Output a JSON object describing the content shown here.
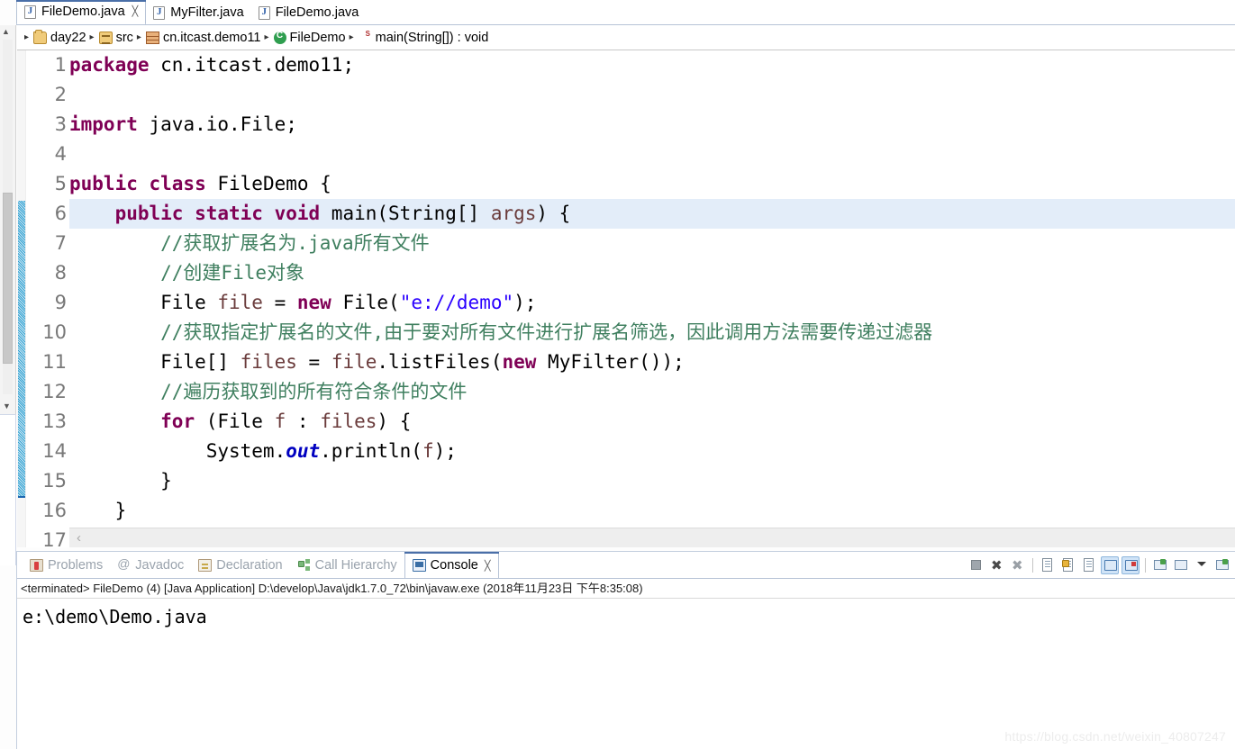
{
  "tabs": [
    {
      "label": "FileDemo.java",
      "icon": "java-file-icon",
      "active": true,
      "close": "╳"
    },
    {
      "label": "MyFilter.java",
      "icon": "java-file-icon",
      "active": false,
      "close": ""
    },
    {
      "label": "FileDemo.java",
      "icon": "java-file-icon",
      "active": false,
      "close": ""
    }
  ],
  "breadcrumb": {
    "leading_arrow": "▸",
    "separator": "▸",
    "items": [
      {
        "label": "day22",
        "icon": "project-folder-icon"
      },
      {
        "label": "src",
        "icon": "source-folder-icon"
      },
      {
        "label": "cn.itcast.demo11",
        "icon": "package-icon"
      },
      {
        "label": "FileDemo",
        "icon": "class-icon"
      },
      {
        "label": "main(String[]) : void",
        "icon": "method-icon"
      }
    ]
  },
  "editor": {
    "current_line": 6,
    "scroll_arrow": "‹",
    "lines": [
      {
        "num": "1",
        "tokens": [
          {
            "t": "package ",
            "c": "kw"
          },
          {
            "t": "cn.itcast.demo11;",
            "c": "pln"
          }
        ]
      },
      {
        "num": "2",
        "tokens": []
      },
      {
        "num": "3",
        "tokens": [
          {
            "t": "import ",
            "c": "kw"
          },
          {
            "t": "java.io.File;",
            "c": "pln"
          }
        ]
      },
      {
        "num": "4",
        "tokens": []
      },
      {
        "num": "5",
        "tokens": [
          {
            "t": "public class ",
            "c": "kw"
          },
          {
            "t": "FileDemo {",
            "c": "pln"
          }
        ]
      },
      {
        "num": "6",
        "tokens": [
          {
            "t": "    ",
            "c": "pln"
          },
          {
            "t": "public static void ",
            "c": "kw"
          },
          {
            "t": "main(String[] ",
            "c": "pln"
          },
          {
            "t": "args",
            "c": "loc"
          },
          {
            "t": ") {",
            "c": "pln"
          }
        ]
      },
      {
        "num": "7",
        "tokens": [
          {
            "t": "        //获取扩展名为.java所有文件",
            "c": "cmt"
          }
        ]
      },
      {
        "num": "8",
        "tokens": [
          {
            "t": "        //创建File对象",
            "c": "cmt"
          }
        ]
      },
      {
        "num": "9",
        "tokens": [
          {
            "t": "        File ",
            "c": "pln"
          },
          {
            "t": "file",
            "c": "loc"
          },
          {
            "t": " = ",
            "c": "pln"
          },
          {
            "t": "new ",
            "c": "kw"
          },
          {
            "t": "File(",
            "c": "pln"
          },
          {
            "t": "\"e://demo\"",
            "c": "str"
          },
          {
            "t": ");",
            "c": "pln"
          }
        ]
      },
      {
        "num": "10",
        "tokens": [
          {
            "t": "        //获取指定扩展名的文件,由于要对所有文件进行扩展名筛选，因此调用方法需要传递过滤器",
            "c": "cmt"
          }
        ]
      },
      {
        "num": "11",
        "tokens": [
          {
            "t": "        File[] ",
            "c": "pln"
          },
          {
            "t": "files",
            "c": "loc"
          },
          {
            "t": " = ",
            "c": "pln"
          },
          {
            "t": "file",
            "c": "loc"
          },
          {
            "t": ".listFiles(",
            "c": "pln"
          },
          {
            "t": "new ",
            "c": "kw"
          },
          {
            "t": "MyFilter());",
            "c": "pln"
          }
        ]
      },
      {
        "num": "12",
        "tokens": [
          {
            "t": "        //遍历获取到的所有符合条件的文件",
            "c": "cmt"
          }
        ]
      },
      {
        "num": "13",
        "tokens": [
          {
            "t": "        ",
            "c": "pln"
          },
          {
            "t": "for ",
            "c": "kw"
          },
          {
            "t": "(File ",
            "c": "pln"
          },
          {
            "t": "f",
            "c": "loc"
          },
          {
            "t": " : ",
            "c": "pln"
          },
          {
            "t": "files",
            "c": "loc"
          },
          {
            "t": ") {",
            "c": "pln"
          }
        ]
      },
      {
        "num": "14",
        "tokens": [
          {
            "t": "            System.",
            "c": "pln"
          },
          {
            "t": "out",
            "c": "fld"
          },
          {
            "t": ".println(",
            "c": "pln"
          },
          {
            "t": "f",
            "c": "loc"
          },
          {
            "t": ");",
            "c": "pln"
          }
        ]
      },
      {
        "num": "15",
        "tokens": [
          {
            "t": "        }",
            "c": "pln"
          }
        ]
      },
      {
        "num": "16",
        "tokens": [
          {
            "t": "    }",
            "c": "pln"
          }
        ]
      },
      {
        "num": "17",
        "tokens": []
      }
    ]
  },
  "bottom_view": {
    "tabs": [
      {
        "label": "Problems",
        "icon": "problems-icon",
        "active": false,
        "close": ""
      },
      {
        "label": "Javadoc",
        "icon": "javadoc-icon",
        "active": false,
        "close": ""
      },
      {
        "label": "Declaration",
        "icon": "declaration-icon",
        "active": false,
        "close": ""
      },
      {
        "label": "Call Hierarchy",
        "icon": "call-hierarchy-icon",
        "active": false,
        "close": ""
      },
      {
        "label": "Console",
        "icon": "console-icon",
        "active": true,
        "close": "╳"
      }
    ],
    "toolbar": [
      {
        "name": "terminate-button",
        "kind": "stop"
      },
      {
        "name": "remove-launch-button",
        "kind": "x"
      },
      {
        "name": "remove-all-launches-button",
        "kind": "xx"
      },
      {
        "name": "separator-1",
        "kind": "sep"
      },
      {
        "name": "clear-console-button",
        "kind": "doc-x"
      },
      {
        "name": "scroll-lock-button",
        "kind": "lock"
      },
      {
        "name": "word-wrap-button",
        "kind": "doc-wrap"
      },
      {
        "name": "show-console-on-output-button",
        "kind": "scr",
        "selected": true
      },
      {
        "name": "show-console-on-error-button",
        "kind": "scr-red",
        "selected": true
      },
      {
        "name": "separator-2",
        "kind": "sep"
      },
      {
        "name": "pin-console-button",
        "kind": "win-green"
      },
      {
        "name": "display-selected-console-button",
        "kind": "win"
      },
      {
        "name": "console-menu-dropdown",
        "kind": "caret"
      },
      {
        "name": "open-console-button",
        "kind": "win-open"
      }
    ],
    "process_line": "<terminated> FileDemo (4) [Java Application] D:\\develop\\Java\\jdk1.7.0_72\\bin\\javaw.exe (2018年11月23日 下午8:35:08)",
    "output_lines": [
      "e:\\demo\\Demo.java"
    ]
  },
  "watermark": "https://blog.csdn.net/weixin_40807247"
}
